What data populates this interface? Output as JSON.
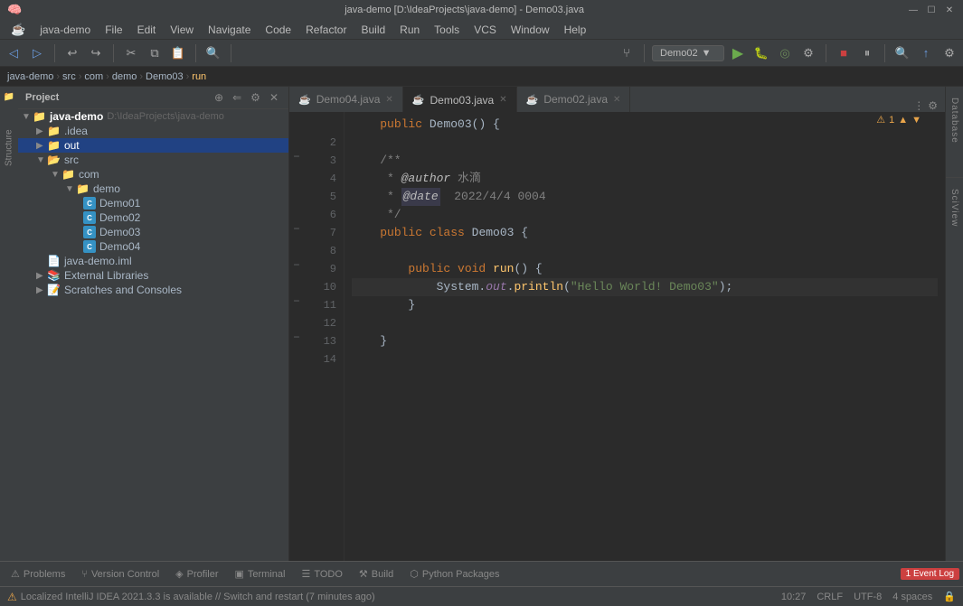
{
  "titleBar": {
    "projectPath": "java-demo [D:\\IdeaProjects\\java-demo] - Demo03.java",
    "winMin": "—",
    "winMax": "☐",
    "winClose": "✕"
  },
  "menuBar": {
    "items": [
      "java-demo",
      "File",
      "Edit",
      "View",
      "Navigate",
      "Code",
      "Refactor",
      "Build",
      "Run",
      "Tools",
      "VCS",
      "Window",
      "Help"
    ]
  },
  "toolbar": {
    "runConfig": "Demo02",
    "runConfigArrow": "▼"
  },
  "breadcrumb": {
    "items": [
      "java-demo",
      "src",
      "com",
      "demo",
      "Demo03",
      "run"
    ]
  },
  "projectPanel": {
    "title": "Project",
    "root": {
      "name": "java-demo",
      "path": "D:\\IdeaProjects\\java-demo",
      "children": [
        {
          "name": ".idea",
          "type": "folder",
          "indent": 1
        },
        {
          "name": "out",
          "type": "folder-selected",
          "indent": 1
        },
        {
          "name": "src",
          "type": "folder",
          "indent": 1,
          "children": [
            {
              "name": "com",
              "type": "folder",
              "indent": 2,
              "children": [
                {
                  "name": "demo",
                  "type": "folder",
                  "indent": 3,
                  "children": [
                    {
                      "name": "Demo01",
                      "type": "class",
                      "indent": 4
                    },
                    {
                      "name": "Demo02",
                      "type": "class",
                      "indent": 4
                    },
                    {
                      "name": "Demo03",
                      "type": "class",
                      "indent": 4
                    },
                    {
                      "name": "Demo04",
                      "type": "class",
                      "indent": 4
                    }
                  ]
                }
              ]
            }
          ]
        },
        {
          "name": "java-demo.iml",
          "type": "iml",
          "indent": 1
        },
        {
          "name": "External Libraries",
          "type": "lib",
          "indent": 1
        },
        {
          "name": "Scratches and Consoles",
          "type": "scratches",
          "indent": 1
        }
      ]
    }
  },
  "tabs": [
    {
      "label": "Demo04.java",
      "active": false
    },
    {
      "label": "Demo03.java",
      "active": true
    },
    {
      "label": "Demo02.java",
      "active": false
    }
  ],
  "editor": {
    "warningCount": "⚠ 1",
    "lines": [
      {
        "num": "",
        "content": "    public Demo03() {",
        "type": "comment-line"
      },
      {
        "num": "2",
        "content": ""
      },
      {
        "num": "3",
        "content": "    /**"
      },
      {
        "num": "4",
        "content": "     * @author 水滴"
      },
      {
        "num": "5",
        "content": "     * @date  2022/4/4 0004"
      },
      {
        "num": "6",
        "content": "     */"
      },
      {
        "num": "7",
        "content": "    public class Demo03 {"
      },
      {
        "num": "8",
        "content": ""
      },
      {
        "num": "9",
        "content": "        public void run() {"
      },
      {
        "num": "10",
        "content": "            System.out.println(\"Hello World! Demo03\");"
      },
      {
        "num": "11",
        "content": "        }"
      },
      {
        "num": "12",
        "content": ""
      },
      {
        "num": "13",
        "content": "    }"
      },
      {
        "num": "14",
        "content": ""
      }
    ]
  },
  "statusBar": {
    "message": "Localized IntelliJ IDEA 2021.3.3 is available // Switch and restart (7 minutes ago)",
    "position": "10:27",
    "lineEnding": "CRLF",
    "encoding": "UTF-8",
    "indent": "4 spaces",
    "eventLog": "1 Event Log"
  },
  "bottomTabs": [
    {
      "label": "Problems",
      "icon": "⚠"
    },
    {
      "label": "Version Control",
      "icon": "⑂"
    },
    {
      "label": "Profiler",
      "icon": "◈"
    },
    {
      "label": "Terminal",
      "icon": "▣"
    },
    {
      "label": "TODO",
      "icon": "☰"
    },
    {
      "label": "Build",
      "icon": "⚒"
    },
    {
      "label": "Python Packages",
      "icon": "⬡"
    }
  ]
}
